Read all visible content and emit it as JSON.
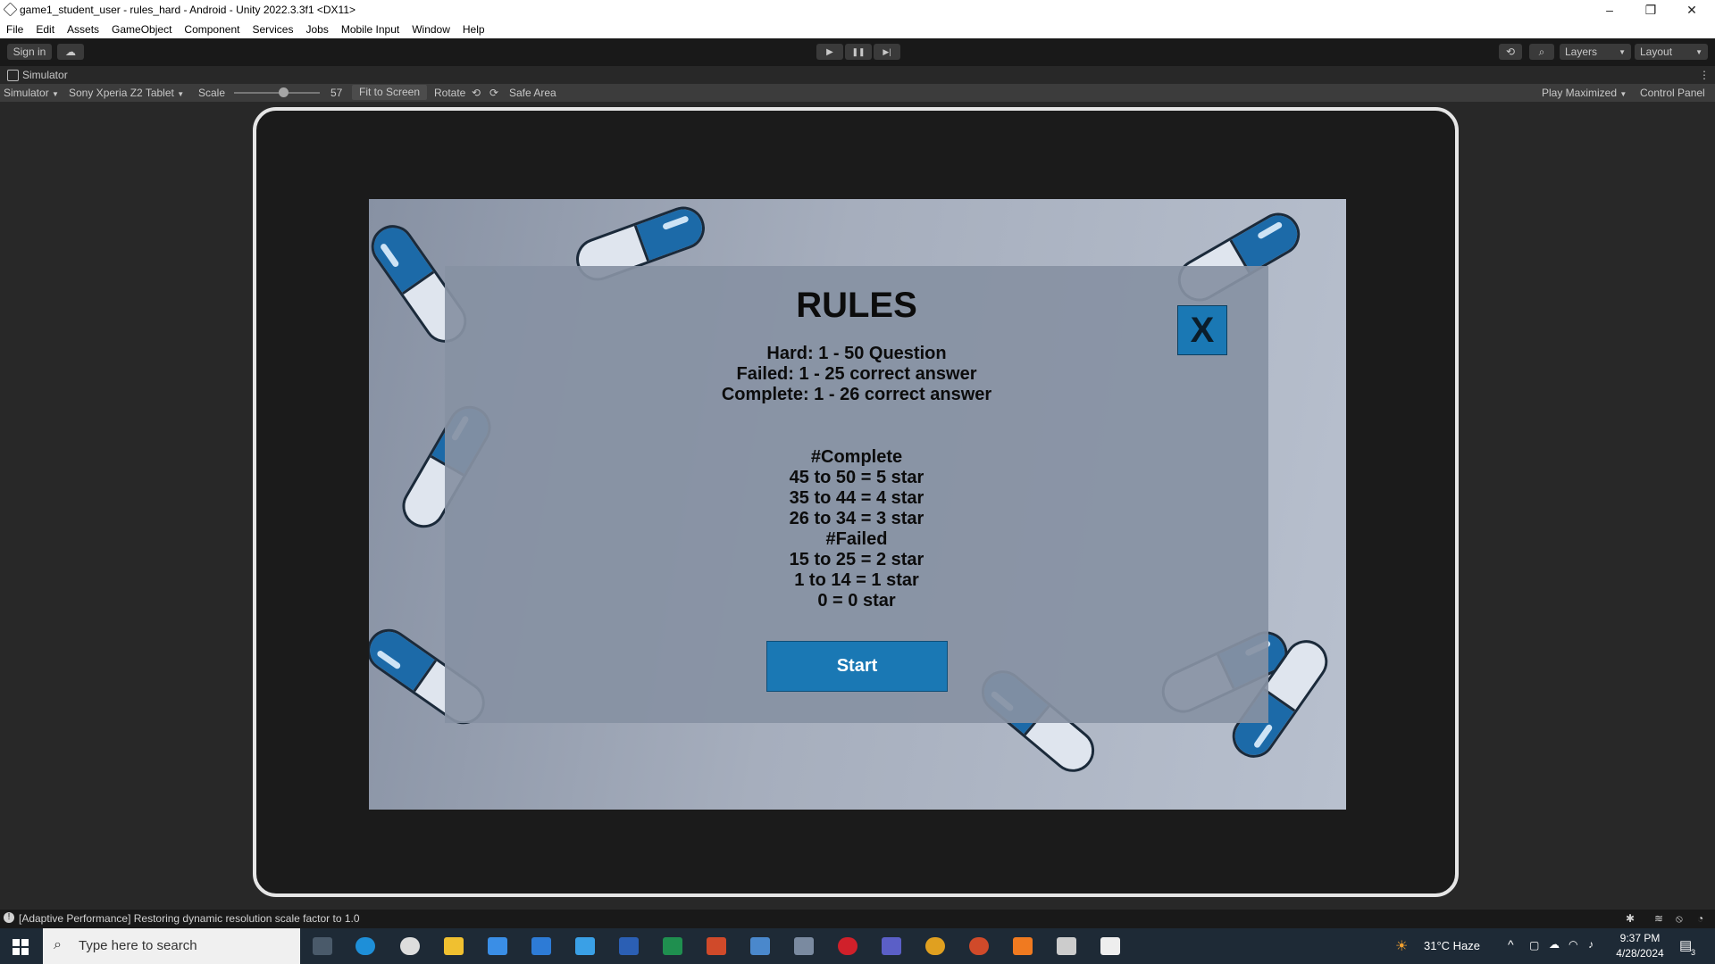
{
  "window": {
    "title": "game1_student_user - rules_hard - Android - Unity 2022.3.3f1 <DX11>",
    "minimize": "–",
    "restore": "❐",
    "close": "✕"
  },
  "menu": [
    "File",
    "Edit",
    "Assets",
    "GameObject",
    "Component",
    "Services",
    "Jobs",
    "Mobile Input",
    "Window",
    "Help"
  ],
  "toolbar": {
    "sign_in": "Sign in",
    "cloud": "☁",
    "play": "▶",
    "pause": "❚❚",
    "step": "▶|",
    "history": "⟲",
    "search": "⌕",
    "layers": "Layers",
    "layout": "Layout"
  },
  "simulator": {
    "tab_label": "Simulator",
    "view_dropdown": "Simulator",
    "device_dropdown": "Sony Xperia Z2 Tablet",
    "scale_label": "Scale",
    "scale_value": "57",
    "scale_fraction": 0.57,
    "fit_to_screen": "Fit to Screen",
    "rotate_label": "Rotate",
    "safe_area": "Safe Area",
    "play_mode": "Play Maximized",
    "control_panel": "Control Panel",
    "more": "⋮"
  },
  "game": {
    "rules_title": "RULES",
    "summary_lines": [
      "Hard: 1 - 50 Question",
      "Failed: 1 - 25 correct answer",
      "Complete: 1 - 26 correct answer"
    ],
    "star_lines": [
      "#Complete",
      "45 to 50 = 5 star",
      "35 to 44 = 4 star",
      "26 to 34 = 3 star",
      "#Failed",
      "15 to 25 = 2 star",
      "1 to 14 = 1 star",
      "0 = 0 star"
    ],
    "close_label": "X",
    "start_label": "Start",
    "colors": {
      "button": "#1a78b4",
      "pill_blue": "#1c6aa8",
      "panel": "#8791a3"
    }
  },
  "status": {
    "message": "[Adaptive Performance] Restoring dynamic resolution scale factor to 1.0"
  },
  "taskbar": {
    "search_placeholder": "Type here to search",
    "weather": "31°C  Haze",
    "time": "9:37 PM",
    "date": "4/28/2024",
    "notifications": "3"
  }
}
